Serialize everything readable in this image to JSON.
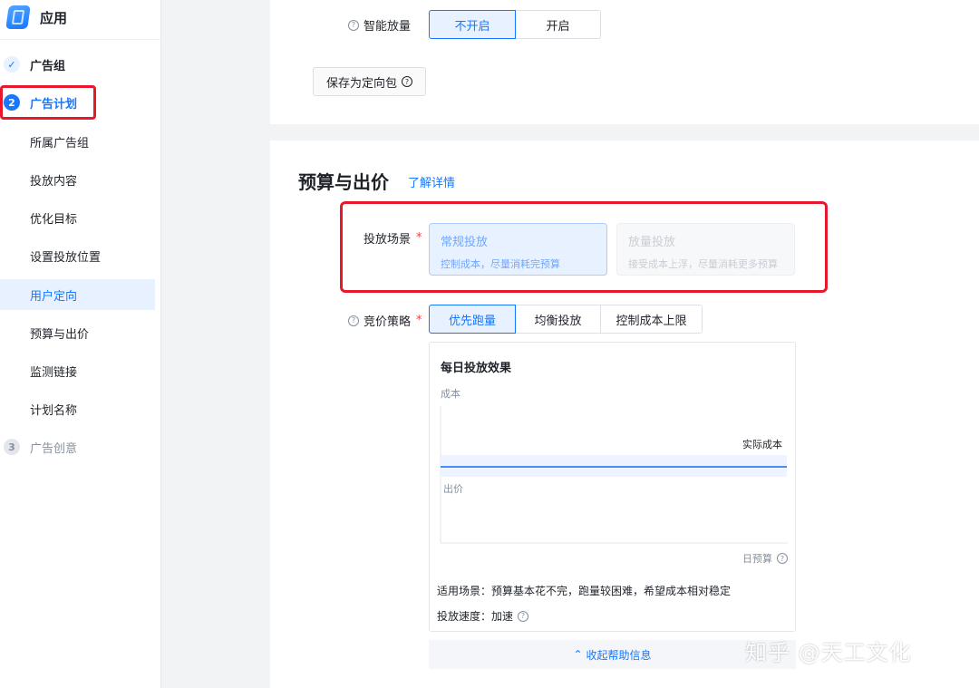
{
  "app": {
    "title": "应用"
  },
  "steps": [
    {
      "icon": "✓",
      "label": "广告组",
      "state": "done"
    },
    {
      "icon": "2",
      "label": "广告计划",
      "state": "active"
    },
    {
      "icon": "3",
      "label": "广告创意",
      "state": "todo"
    }
  ],
  "sub_nav": [
    "所属广告组",
    "投放内容",
    "优化目标",
    "设置投放位置",
    "用户定向",
    "预算与出价",
    "监测链接",
    "计划名称"
  ],
  "smart_boost": {
    "label": "智能放量",
    "options": [
      "不开启",
      "开启"
    ],
    "selected": "不开启"
  },
  "save_package_label": "保存为定向包",
  "budget": {
    "title": "预算与出价",
    "link": "了解详情",
    "scene": {
      "label": "投放场景",
      "options": [
        {
          "title": "常规投放",
          "desc": "控制成本，尽量消耗完预算"
        },
        {
          "title": "放量投放",
          "desc": "接受成本上浮，尽量消耗更多预算"
        }
      ]
    },
    "strategy": {
      "label": "竞价策略",
      "options": [
        "优先跑量",
        "均衡投放",
        "控制成本上限"
      ],
      "selected": "优先跑量"
    }
  },
  "effect": {
    "title": "每日投放效果",
    "y_label": "成本",
    "line_label": "实际成本",
    "lower_label": "出价",
    "x_label": "日预算",
    "scene_text": "适用场景：预算基本花不完，跑量较困难，希望成本相对稳定",
    "speed_text": "投放速度：加速"
  },
  "collapse_label": "收起帮助信息",
  "watermark": "知乎 @天工文化",
  "colors": {
    "accent": "#1677ff",
    "highlight": "#e8182a"
  }
}
